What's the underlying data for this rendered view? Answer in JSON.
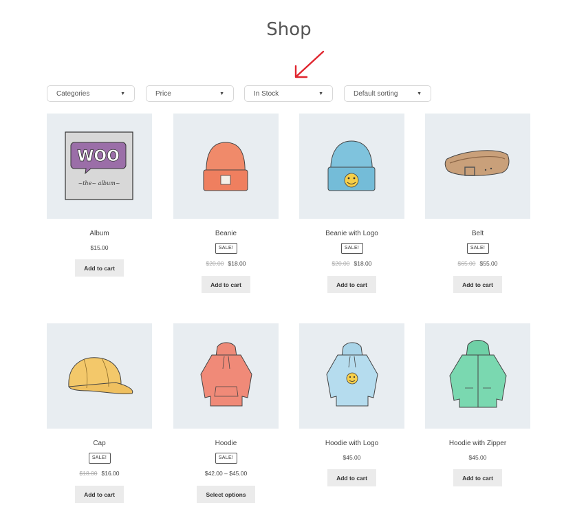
{
  "page": {
    "title": "Shop"
  },
  "filters": [
    {
      "label": "Categories"
    },
    {
      "label": "Price"
    },
    {
      "label": "In Stock"
    },
    {
      "label": "Default sorting"
    }
  ],
  "products": [
    {
      "name": "Album",
      "sale": "",
      "old_price": "",
      "price": "$15.00",
      "button": "Add to cart",
      "image": "album-image"
    },
    {
      "name": "Beanie",
      "sale": "SALE!",
      "old_price": "$20.00",
      "price": "$18.00",
      "button": "Add to cart",
      "image": "beanie-image"
    },
    {
      "name": "Beanie with Logo",
      "sale": "SALE!",
      "old_price": "$20.00",
      "price": "$18.00",
      "button": "Add to cart",
      "image": "beanie-with-logo-image"
    },
    {
      "name": "Belt",
      "sale": "SALE!",
      "old_price": "$65.00",
      "price": "$55.00",
      "button": "Add to cart",
      "image": "belt-image"
    },
    {
      "name": "Cap",
      "sale": "SALE!",
      "old_price": "$18.00",
      "price": "$16.00",
      "button": "Add to cart",
      "image": "cap-image"
    },
    {
      "name": "Hoodie",
      "sale": "SALE!",
      "old_price": "",
      "price": "$42.00 – $45.00",
      "button": "Select options",
      "image": "hoodie-image"
    },
    {
      "name": "Hoodie with Logo",
      "sale": "",
      "old_price": "",
      "price": "$45.00",
      "button": "Add to cart",
      "image": "hoodie-with-logo-image"
    },
    {
      "name": "Hoodie with Zipper",
      "sale": "",
      "old_price": "",
      "price": "$45.00",
      "button": "Add to cart",
      "image": "hoodie-with-zipper-image"
    }
  ],
  "colors": {
    "accent_arrow": "#e0262f",
    "thumb_bg": "#e8edf1",
    "button_bg": "#ebebeb"
  }
}
